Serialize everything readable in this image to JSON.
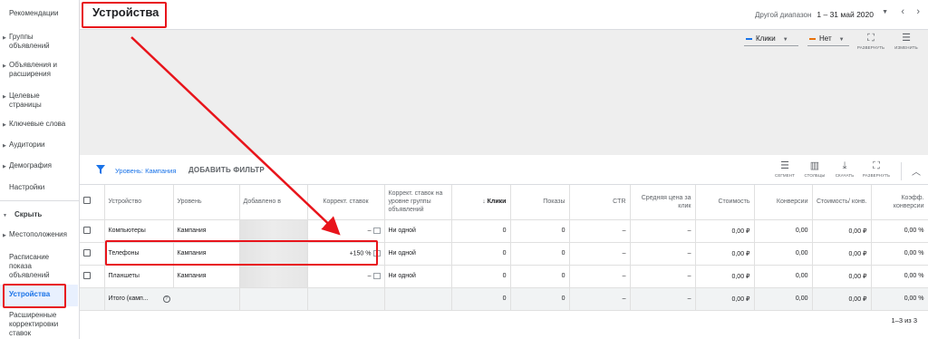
{
  "sidebar": {
    "items": [
      {
        "label": "Рекомендации",
        "caret": false
      },
      {
        "label": "Группы объявлений",
        "caret": true
      },
      {
        "label": "Объявления и расширения",
        "caret": true
      },
      {
        "label": "Целевые страницы",
        "caret": true
      },
      {
        "label": "Ключевые слова",
        "caret": true
      },
      {
        "label": "Аудитории",
        "caret": true
      },
      {
        "label": "Демография",
        "caret": true
      },
      {
        "label": "Настройки",
        "caret": false
      }
    ],
    "hide_label": "Скрыть",
    "hidden_items": [
      {
        "label": "Местоположения"
      },
      {
        "label": "Расписание показа объявлений"
      },
      {
        "label": "Устройства",
        "active": true
      },
      {
        "label": "Расширенные корректировки ставок"
      }
    ]
  },
  "header": {
    "title": "Устройства",
    "date_range_label": "Другой диапазон",
    "date_range_value": "1 – 31 май 2020"
  },
  "chart_controls": {
    "metric1": "Клики",
    "metric2": "Нет",
    "metric1_color": "#1a73e8",
    "metric2_color": "#e8710a",
    "expand_label": "РАЗВЕРНУТЬ",
    "edit_label": "ИЗМЕНИТЬ"
  },
  "filter": {
    "level_prefix": "Уровень:",
    "level_value": "Кампания",
    "add_filter": "ДОБАВИТЬ ФИЛЬТР"
  },
  "toolbar": {
    "segment": "СЕГМЕНТ",
    "columns": "СТОЛБЦЫ",
    "download": "СКАЧАТЬ",
    "expand": "РАЗВЕРНУТЬ"
  },
  "table": {
    "headers": {
      "device": "Устройство",
      "level": "Уровень",
      "added_to": "Добавлено в",
      "bid_adj": "Коррект. ставок",
      "bid_adj_group": "Коррект. ставок на уровне группы объявлений",
      "clicks": "Клики",
      "impressions": "Показы",
      "ctr": "CTR",
      "avg_cpc": "Средняя цена за клик",
      "cost": "Стоимость",
      "conversions": "Конверсии",
      "cost_conv": "Стоимость/ конв.",
      "conv_rate": "Коэфф. конверсии"
    },
    "rows": [
      {
        "device": "Компьютеры",
        "level": "Кампания",
        "bid_adj": "–",
        "bid_adj_group": "Ни одной",
        "clicks": "0",
        "impressions": "0",
        "ctr": "–",
        "avg_cpc": "–",
        "cost": "0,00 ₽",
        "conversions": "0,00",
        "cost_conv": "0,00 ₽",
        "conv_rate": "0,00 %"
      },
      {
        "device": "Телефоны",
        "level": "Кампания",
        "bid_adj": "+150 %",
        "bid_adj_group": "Ни одной",
        "clicks": "0",
        "impressions": "0",
        "ctr": "–",
        "avg_cpc": "–",
        "cost": "0,00 ₽",
        "conversions": "0,00",
        "cost_conv": "0,00 ₽",
        "conv_rate": "0,00 %"
      },
      {
        "device": "Планшеты",
        "level": "Кампания",
        "bid_adj": "–",
        "bid_adj_group": "Ни одной",
        "clicks": "0",
        "impressions": "0",
        "ctr": "–",
        "avg_cpc": "–",
        "cost": "0,00 ₽",
        "conversions": "0,00",
        "cost_conv": "0,00 ₽",
        "conv_rate": "0,00 %"
      }
    ],
    "total": {
      "label": "Итого (камп...",
      "clicks": "0",
      "impressions": "0",
      "ctr": "–",
      "avg_cpc": "–",
      "cost": "0,00 ₽",
      "conversions": "0,00",
      "cost_conv": "0,00 ₽",
      "conv_rate": "0,00 %"
    }
  },
  "pagination": "1–3 из 3",
  "annotation_color": "#e8141b"
}
